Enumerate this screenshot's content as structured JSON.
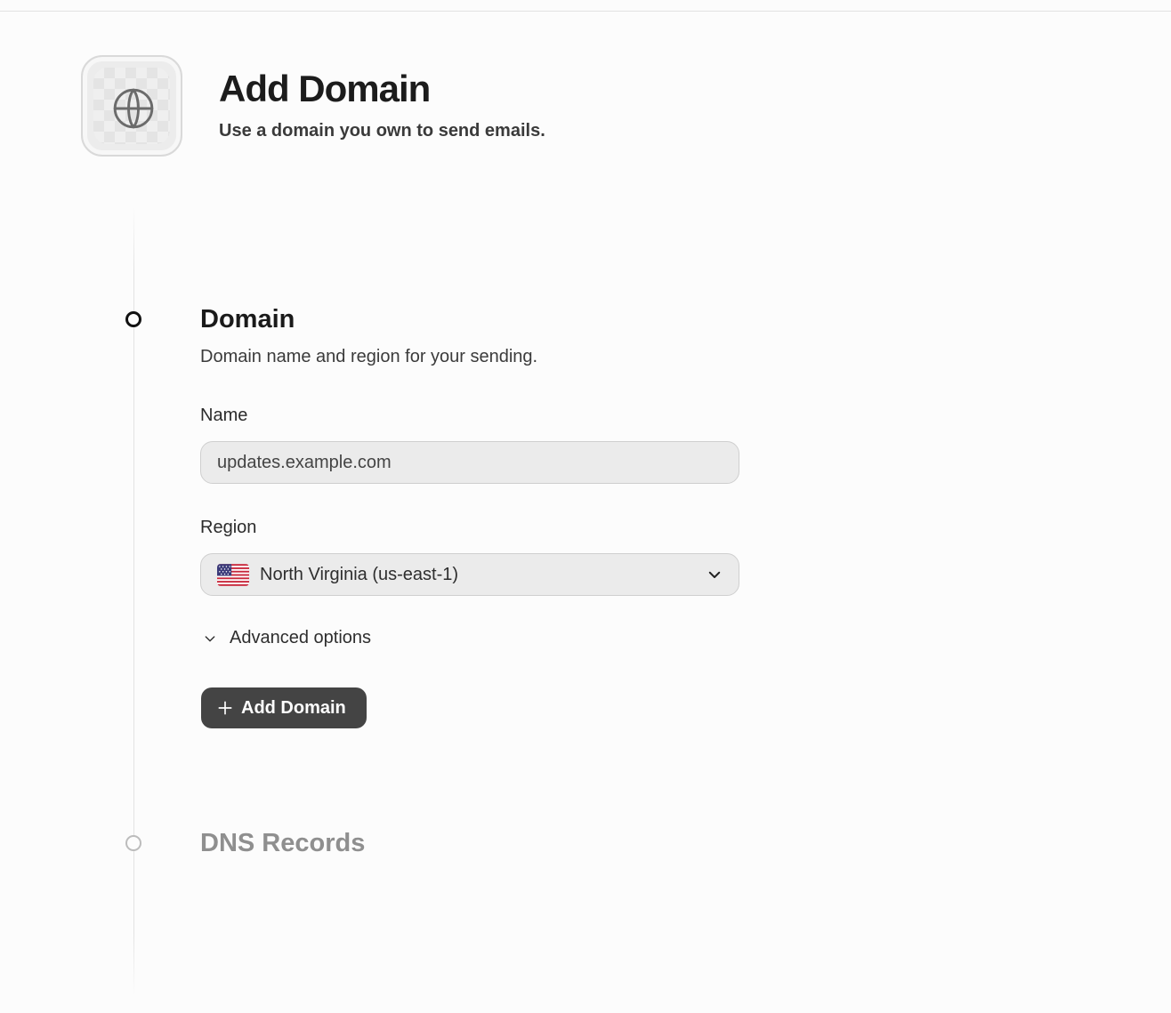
{
  "header": {
    "icon": "globe-icon",
    "title": "Add Domain",
    "subtitle": "Use a domain you own to send emails."
  },
  "steps": [
    {
      "title": "Domain",
      "description": "Domain name and region for your sending.",
      "state": "active",
      "fields": {
        "name": {
          "label": "Name",
          "placeholder": "updates.example.com",
          "value": ""
        },
        "region": {
          "label": "Region",
          "selected": "North Virginia (us-east-1)",
          "flag": "us-flag-icon"
        }
      },
      "advanced_label": "Advanced options",
      "submit_label": "Add Domain"
    },
    {
      "title": "DNS Records",
      "state": "inactive"
    }
  ],
  "colors": {
    "background": "#fcfcfc",
    "button_bg": "#444444",
    "input_bg": "#ebebeb",
    "inactive_text": "#8f8f8f"
  }
}
